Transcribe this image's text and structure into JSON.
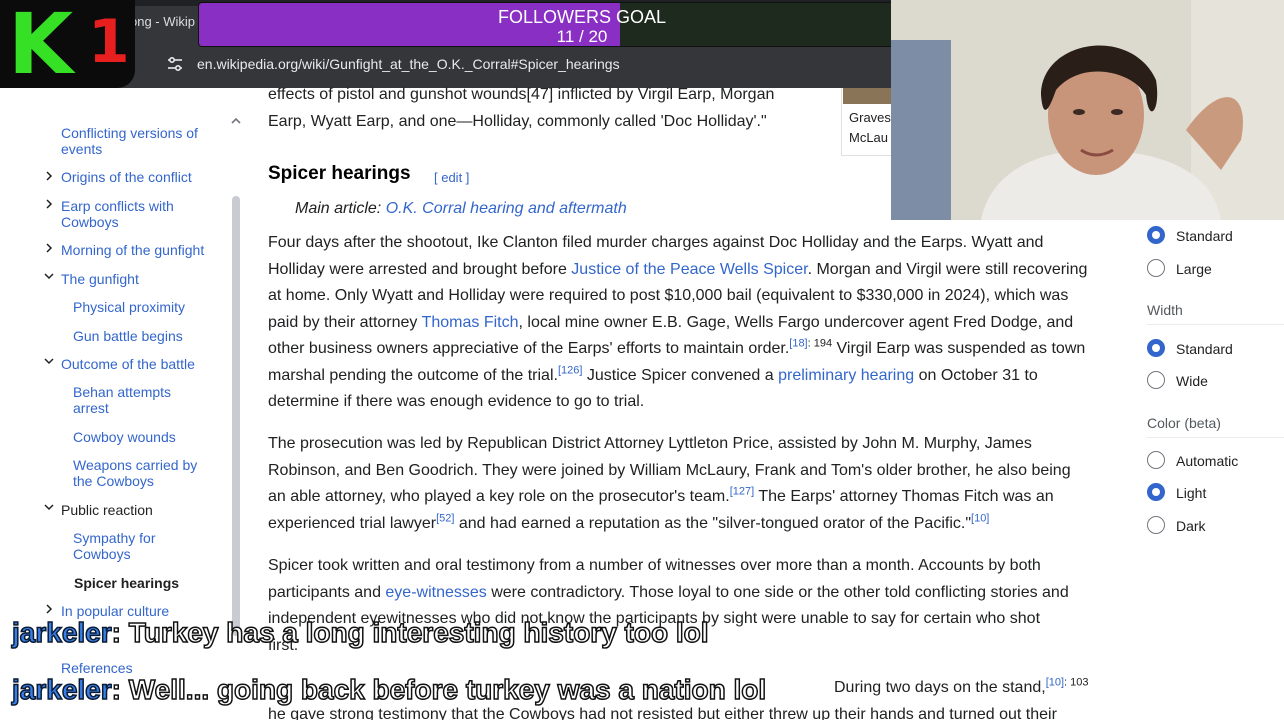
{
  "browser": {
    "tab_title": "ong - Wikip",
    "url": "en.wikipedia.org/wiki/Gunfight_at_the_O.K._Corral#Spicer_hearings"
  },
  "overlay": {
    "logo_letter": "K",
    "logo_number": "1",
    "goal_title": "FOLLOWERS GOAL",
    "goal_count": "11 / 20",
    "goal_progress": 0.55,
    "colors": {
      "logo_letter": "#35e025",
      "logo_number": "#e81f1f",
      "goal_fill": "#8a2fc4"
    }
  },
  "toc": {
    "items": [
      {
        "label": "Conflicting versions of events",
        "has_toggle": false
      },
      {
        "label": "Origins of the conflict",
        "has_toggle": true,
        "toggle": "chevron-right"
      },
      {
        "label": "Earp conflicts with Cowboys",
        "has_toggle": true,
        "toggle": "chevron-right"
      },
      {
        "label": "Morning of the gunfight",
        "has_toggle": true,
        "toggle": "chevron-right"
      },
      {
        "label": "The gunfight",
        "has_toggle": true,
        "toggle": "chevron-down"
      },
      {
        "label": "Physical proximity",
        "sub": true
      },
      {
        "label": "Gun battle begins",
        "sub": true
      },
      {
        "label": "Outcome of the battle",
        "has_toggle": true,
        "toggle": "chevron-down"
      },
      {
        "label": "Behan attempts arrest",
        "sub": true
      },
      {
        "label": "Cowboy wounds",
        "sub": true
      },
      {
        "label": "Weapons carried by the Cowboys",
        "sub": true
      },
      {
        "label": "Public reaction",
        "has_toggle": true,
        "toggle": "chevron-down"
      },
      {
        "label": "Sympathy for Cowboys",
        "sub": true
      },
      {
        "label": "Spicer hearings",
        "sub": true,
        "active": true
      },
      {
        "label": "In popular culture",
        "has_toggle": true,
        "toggle": "chevron-right"
      },
      {
        "label": "References"
      }
    ]
  },
  "article": {
    "top_lines": [
      "effects of pistol and gunshot wounds[47] inflicted by Virgil Earp, Morgan",
      "Earp, Wyatt Earp, and one—Holliday, commonly called 'Doc Holliday'.\""
    ],
    "heading": "Spicer hearings",
    "edit": "[ edit ]",
    "main_article_prefix": "Main article: ",
    "main_article_link": "O.K. Corral hearing and aftermath",
    "p1": {
      "l1": "Four days after the shootout, Ike Clanton filed murder charges against Doc Holliday and the Earps. Wyatt and",
      "l2a": "Holliday were arrested and brought before ",
      "l2link": "Justice of the Peace Wells Spicer",
      "l2b": ". Morgan and Virgil were still recovering",
      "l3": "at home. Only Wyatt and Holliday were required to post $10,000 bail (equivalent to $330,000 in 2024), which was",
      "l4a": "paid by their attorney ",
      "l4link": "Thomas Fitch",
      "l4b": ", local mine owner E.B. Gage, Wells Fargo undercover agent Fred Dodge, and",
      "l5a": "other business owners appreciative of the Earps' efforts to maintain order.",
      "l5ref": "[18]",
      "l5page": ": 194",
      "l5b": " Virgil Earp was suspended as town",
      "l6a": "marshal pending the outcome of the trial.",
      "l6ref": "[126]",
      "l6b": " Justice Spicer convened a ",
      "l6link": "preliminary hearing",
      "l6c": " on October 31 to",
      "l7": "determine if there was enough evidence to go to trial."
    },
    "p2": {
      "l1": "The prosecution was led by Republican District Attorney Lyttleton Price, assisted by John M. Murphy, James",
      "l2": "Robinson, and Ben Goodrich. They were joined by William McLaury, Frank and Tom's older brother, he also being",
      "l3a": "an able attorney, who played a key role on the prosecutor's team.",
      "l3ref": "[127]",
      "l3b": " The Earps' attorney Thomas Fitch was an",
      "l4a": "experienced trial lawyer",
      "l4ref": "[52]",
      "l4b": " and had earned a reputation as the \"silver-tongued orator of the Pacific.\"",
      "l4ref2": "[10]"
    },
    "p3": {
      "l1": "Spicer took written and oral testimony from a number of witnesses over more than a month. Accounts by both",
      "l2a": "participants and ",
      "l2link": "eye-witnesses",
      "l2b": " were contradictory. Those loyal to one side or the other told conflicting stories and",
      "l3": "independent eyewitnesses who did not know the participants by sight were unable to say for certain who shot",
      "l4": "first."
    },
    "p4": {
      "l1a": "During two days on the stand,",
      "l1ref": "[10]",
      "l1page": ": 103",
      "l2": "he gave strong testimony that the Cowboys had not resisted but either threw up their hands and turned out their"
    },
    "image_caption": [
      "Graves",
      "McLau"
    ]
  },
  "appearance": {
    "text_options": [
      {
        "label": "Standard",
        "selected": true
      },
      {
        "label": "Large",
        "selected": false
      }
    ],
    "width_label": "Width",
    "width_options": [
      {
        "label": "Standard",
        "selected": true
      },
      {
        "label": "Wide",
        "selected": false
      }
    ],
    "color_label": "Color (beta)",
    "color_options": [
      {
        "label": "Automatic",
        "selected": false
      },
      {
        "label": "Light",
        "selected": true
      },
      {
        "label": "Dark",
        "selected": false
      }
    ]
  },
  "chat": [
    {
      "user": "jarkeler",
      "message": ": Turkey has a long interesting history too lol"
    },
    {
      "user": "jarkeler",
      "message": ": Well... going back before turkey was a nation lol"
    }
  ]
}
